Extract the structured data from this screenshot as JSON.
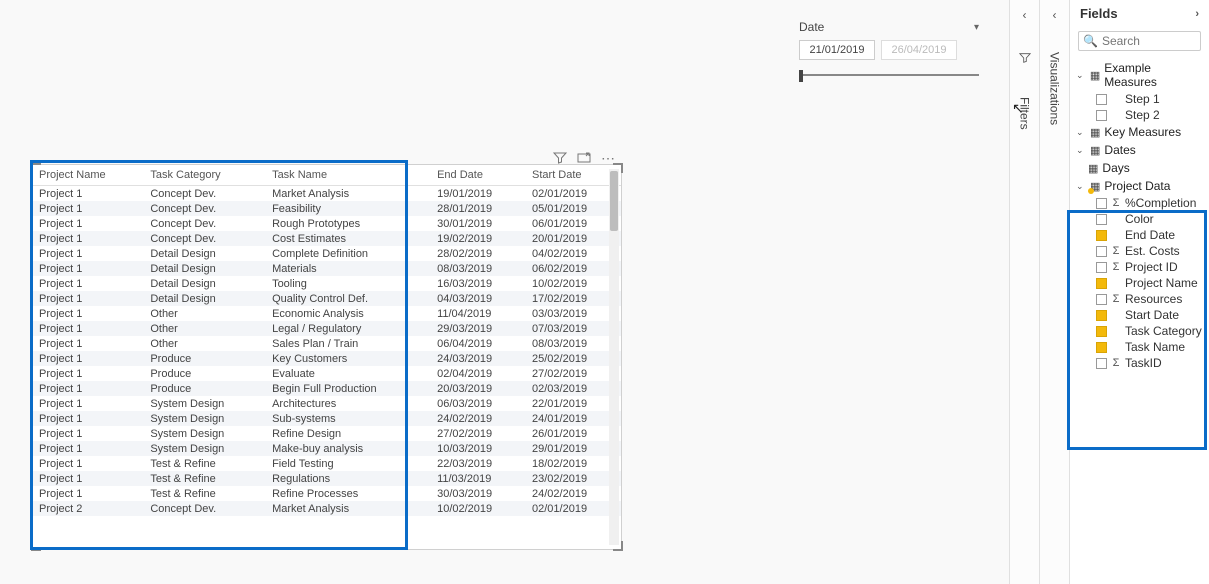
{
  "date_slicer": {
    "label": "Date",
    "start": "21/01/2019",
    "end": "26/04/2019"
  },
  "table": {
    "headers": [
      "Project Name",
      "Task Category",
      "Task Name",
      "End Date",
      "Start Date"
    ],
    "rows": [
      [
        "Project 1",
        "Concept Dev.",
        "Market Analysis",
        "19/01/2019",
        "02/01/2019"
      ],
      [
        "Project 1",
        "Concept Dev.",
        "Feasibility",
        "28/01/2019",
        "05/01/2019"
      ],
      [
        "Project 1",
        "Concept Dev.",
        "Rough Prototypes",
        "30/01/2019",
        "06/01/2019"
      ],
      [
        "Project 1",
        "Concept Dev.",
        "Cost Estimates",
        "19/02/2019",
        "20/01/2019"
      ],
      [
        "Project 1",
        "Detail Design",
        "Complete Definition",
        "28/02/2019",
        "04/02/2019"
      ],
      [
        "Project 1",
        "Detail Design",
        "Materials",
        "08/03/2019",
        "06/02/2019"
      ],
      [
        "Project 1",
        "Detail Design",
        "Tooling",
        "16/03/2019",
        "10/02/2019"
      ],
      [
        "Project 1",
        "Detail Design",
        "Quality Control Def.",
        "04/03/2019",
        "17/02/2019"
      ],
      [
        "Project 1",
        "Other",
        "Economic Analysis",
        "11/04/2019",
        "03/03/2019"
      ],
      [
        "Project 1",
        "Other",
        "Legal / Regulatory",
        "29/03/2019",
        "07/03/2019"
      ],
      [
        "Project 1",
        "Other",
        "Sales Plan / Train",
        "06/04/2019",
        "08/03/2019"
      ],
      [
        "Project 1",
        "Produce",
        "Key Customers",
        "24/03/2019",
        "25/02/2019"
      ],
      [
        "Project 1",
        "Produce",
        "Evaluate",
        "02/04/2019",
        "27/02/2019"
      ],
      [
        "Project 1",
        "Produce",
        "Begin Full Production",
        "20/03/2019",
        "02/03/2019"
      ],
      [
        "Project 1",
        "System Design",
        "Architectures",
        "06/03/2019",
        "22/01/2019"
      ],
      [
        "Project 1",
        "System Design",
        "Sub-systems",
        "24/02/2019",
        "24/01/2019"
      ],
      [
        "Project 1",
        "System Design",
        "Refine Design",
        "27/02/2019",
        "26/01/2019"
      ],
      [
        "Project 1",
        "System Design",
        "Make-buy analysis",
        "10/03/2019",
        "29/01/2019"
      ],
      [
        "Project 1",
        "Test & Refine",
        "Field Testing",
        "22/03/2019",
        "18/02/2019"
      ],
      [
        "Project 1",
        "Test & Refine",
        "Regulations",
        "11/03/2019",
        "23/02/2019"
      ],
      [
        "Project 1",
        "Test & Refine",
        "Refine Processes",
        "30/03/2019",
        "24/02/2019"
      ],
      [
        "Project 2",
        "Concept Dev.",
        "Market Analysis",
        "10/02/2019",
        "02/01/2019"
      ]
    ]
  },
  "panes": {
    "filters": "Filters",
    "visualizations": "Visualizations",
    "fields": "Fields"
  },
  "search_placeholder": "Search",
  "tables": {
    "example": "Example Measures",
    "step1": "Step 1",
    "step2": "Step 2",
    "key": "Key Measures",
    "dates": "Dates",
    "days": "Days",
    "project": "Project Data"
  },
  "fields": {
    "completion": "%Completion",
    "color": "Color",
    "end_date": "End Date",
    "est_costs": "Est. Costs",
    "project_id": "Project ID",
    "project_name": "Project Name",
    "resources": "Resources",
    "start_date": "Start Date",
    "task_category": "Task Category",
    "task_name": "Task Name",
    "task_id": "TaskID"
  }
}
